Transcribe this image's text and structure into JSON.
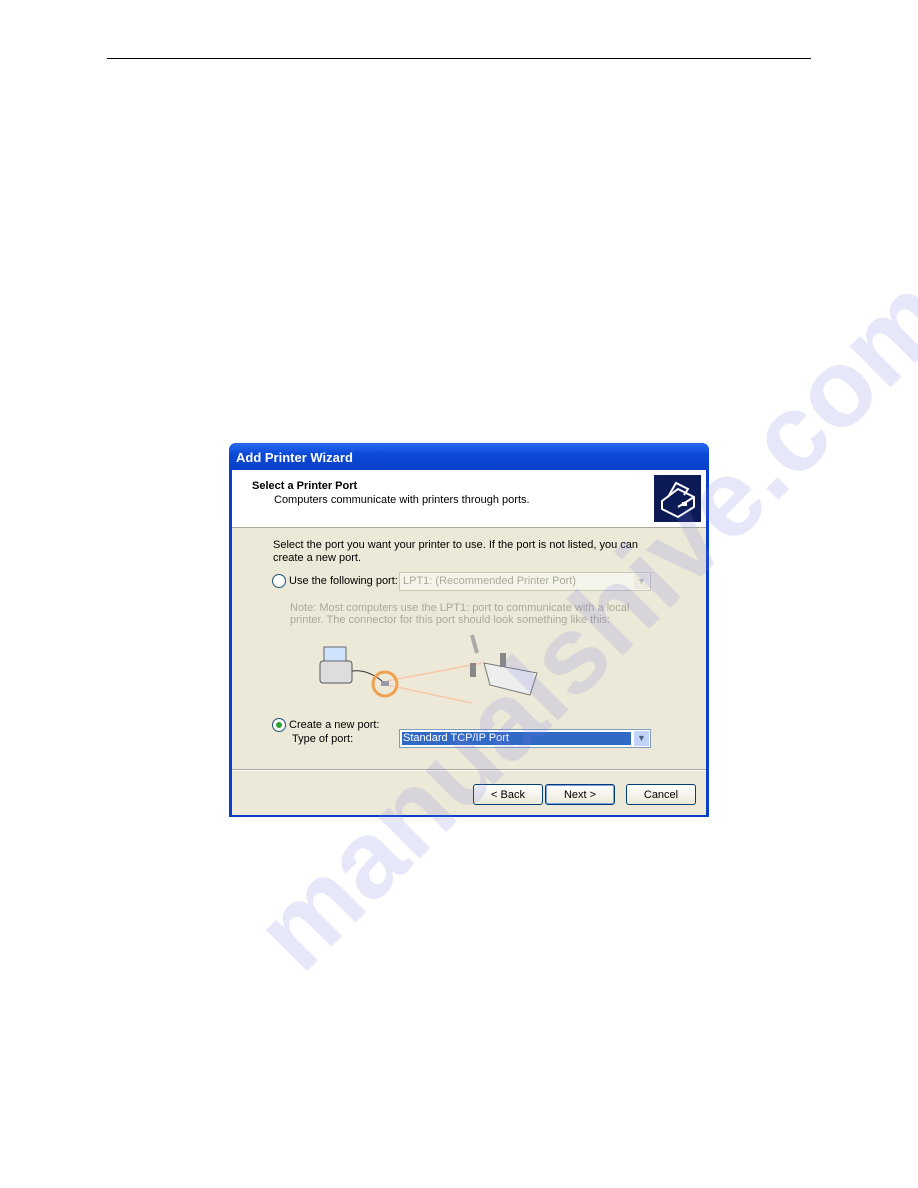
{
  "watermark": "manualshive.com",
  "dialog": {
    "title": "Add Printer Wizard",
    "header_title": "Select a Printer Port",
    "header_subtitle": "Computers communicate with printers through ports.",
    "intro": "Select the port you want your printer to use.  If the port is not listed, you can create a new port.",
    "use_port_label": "Use the following port:",
    "use_port_value": "LPT1: (Recommended Printer Port)",
    "use_port_selected": false,
    "note": "Note: Most computers use the LPT1: port to communicate with a local printer. The connector for this port should look something like this:",
    "create_port_label": "Create a new port:",
    "create_port_selected": true,
    "type_label": "Type of port:",
    "type_value": "Standard TCP/IP Port",
    "buttons": {
      "back": "< Back",
      "next": "Next >",
      "cancel": "Cancel"
    }
  }
}
